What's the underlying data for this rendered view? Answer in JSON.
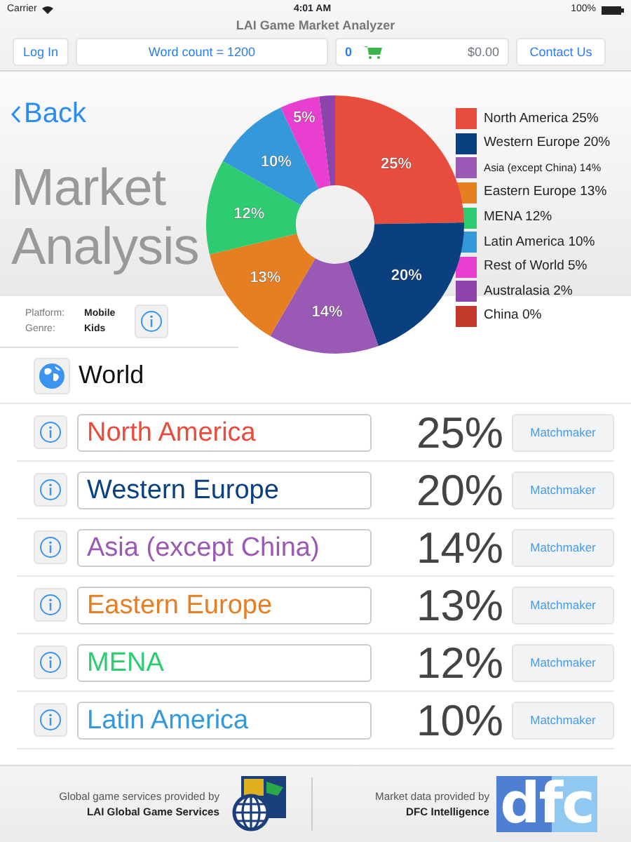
{
  "status_bar": {
    "carrier": "Carrier",
    "time": "4:01 AM",
    "battery": "100%"
  },
  "app_title": "LAI Game Market Analyzer",
  "toolbar": {
    "login": "Log In",
    "word_count": "Word count = 1200",
    "cart_count": "0",
    "cart_total": "$0.00",
    "contact": "Contact Us"
  },
  "back": "Back",
  "title_lines": [
    "Market",
    "Analysis"
  ],
  "platform": {
    "platform_label": "Platform:",
    "platform_value": "Mobile",
    "genre_label": "Genre:",
    "genre_value": "Kids"
  },
  "chart_data": {
    "type": "donut",
    "values": [
      25,
      20,
      14,
      13,
      12,
      10,
      5,
      2,
      0
    ],
    "value_labels": [
      "25%",
      "20%",
      "14%",
      "13%",
      "12%",
      "10%",
      "5%",
      null,
      null
    ]
  },
  "legend": [
    {
      "label": "North America 25%",
      "color": "#e74c3c"
    },
    {
      "label": "Western Europe 20%",
      "color": "#0b4080"
    },
    {
      "label": "Asia (except China) 14%",
      "color": "#9b59b6",
      "kind": "small"
    },
    {
      "label": "Eastern Europe 13%",
      "color": "#e67e22"
    },
    {
      "label": "MENA 12%",
      "color": "#2ecc71"
    },
    {
      "label": "Latin America 10%",
      "color": "#3498db"
    },
    {
      "label": "Rest of World 5%",
      "color": "#e83fd0"
    },
    {
      "label": "Australasia 2%",
      "color": "#8e44ad"
    },
    {
      "label": "China 0%",
      "color": "#c0392b"
    }
  ],
  "world": "World",
  "regions": [
    {
      "name": "North America",
      "color": "#e74c3c",
      "percent": "25%",
      "button": "Matchmaker"
    },
    {
      "name": "Western Europe",
      "color": "#0b4080",
      "percent": "20%",
      "button": "Matchmaker"
    },
    {
      "name": "Asia (except China)",
      "color": "#9b59b6",
      "percent": "14%",
      "button": "Matchmaker"
    },
    {
      "name": "Eastern Europe",
      "color": "#e67e22",
      "percent": "13%",
      "button": "Matchmaker"
    },
    {
      "name": "MENA",
      "color": "#2ecc71",
      "percent": "12%",
      "button": "Matchmaker"
    },
    {
      "name": "Latin America",
      "color": "#3498db",
      "percent": "10%",
      "button": "Matchmaker"
    }
  ],
  "footer": {
    "left_caption": "Global game services provided by",
    "left_company": "LAI Global Game Services",
    "right_caption": "Market data provided by",
    "right_company": "DFC Intelligence",
    "right_logo": "dfc"
  }
}
